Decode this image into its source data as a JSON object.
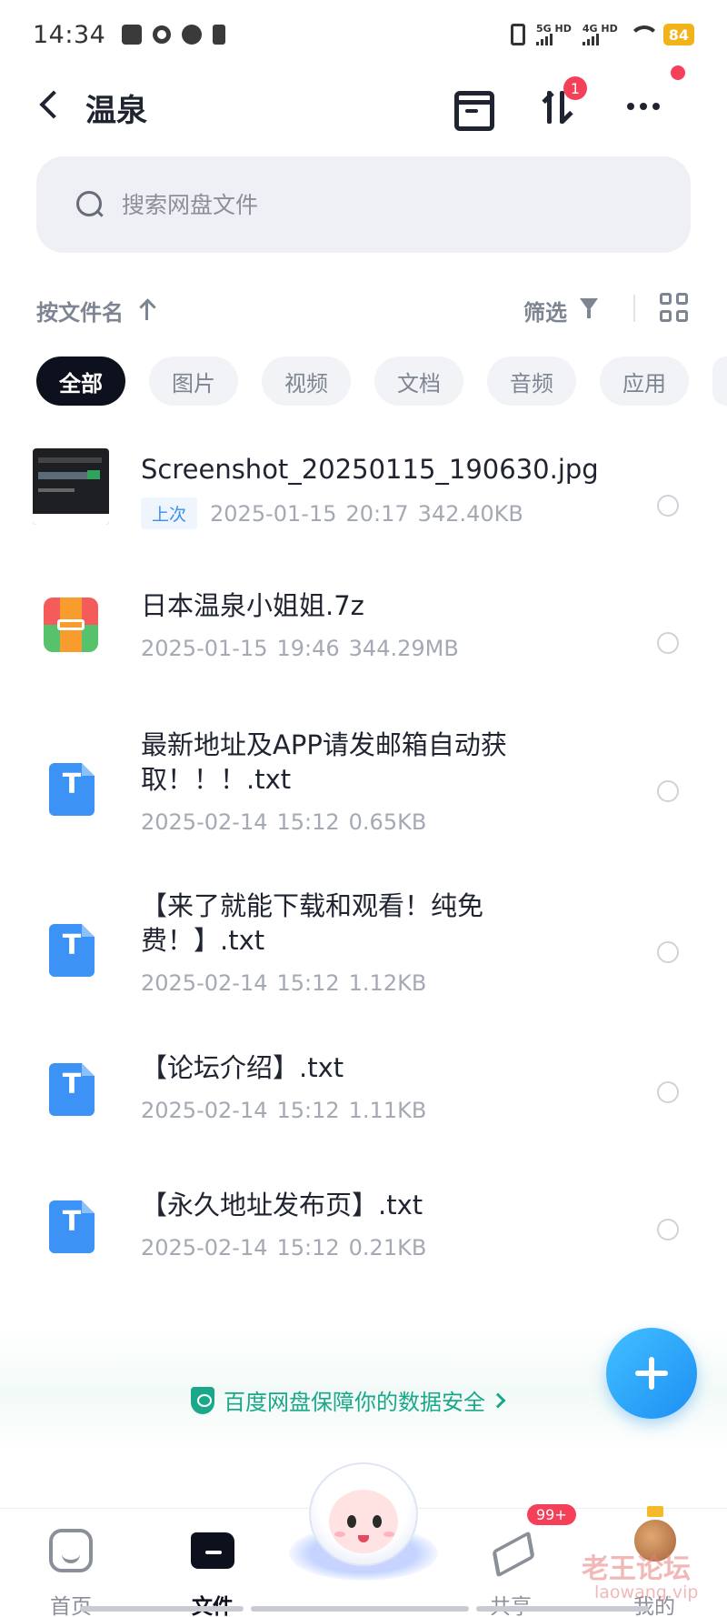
{
  "status_bar": {
    "time": "14:34",
    "network1": "5G HD",
    "network2": "4G HD",
    "battery": "84"
  },
  "header": {
    "title": "温泉",
    "transfer_badge": "1"
  },
  "search": {
    "placeholder": "搜索网盘文件"
  },
  "sort": {
    "label": "按文件名",
    "filter_label": "筛选"
  },
  "tabs": [
    {
      "label": "全部",
      "active": true
    },
    {
      "label": "图片"
    },
    {
      "label": "视频"
    },
    {
      "label": "文档"
    },
    {
      "label": "音频"
    },
    {
      "label": "应用"
    }
  ],
  "files": [
    {
      "name": "Screenshot_20250115_190630.jpg",
      "tag": "上次",
      "date": "2025-01-15",
      "time": "20:17",
      "size": "342.40KB",
      "icon": "image-thumbnail"
    },
    {
      "name": "日本温泉小姐姐.7z",
      "date": "2025-01-15",
      "time": "19:46",
      "size": "344.29MB",
      "icon": "zip-archive-icon"
    },
    {
      "name": "最新地址及APP请发邮箱自动获取！！！.txt",
      "date": "2025-02-14",
      "time": "15:12",
      "size": "0.65KB",
      "icon": "txt-file-icon"
    },
    {
      "name": "【来了就能下载和观看！纯免费！】.txt",
      "date": "2025-02-14",
      "time": "15:12",
      "size": "1.12KB",
      "icon": "txt-file-icon"
    },
    {
      "name": "【论坛介绍】.txt",
      "date": "2025-02-14",
      "time": "15:12",
      "size": "1.11KB",
      "icon": "txt-file-icon"
    },
    {
      "name": "【永久地址发布页】.txt",
      "date": "2025-02-14",
      "time": "15:12",
      "size": "0.21KB",
      "icon": "txt-file-icon"
    }
  ],
  "security_notice": "百度网盘保障你的数据安全",
  "bottom_nav": {
    "home": "首页",
    "files": "文件",
    "share": "共享",
    "mine": "我的",
    "share_badge": "99+"
  },
  "watermark": {
    "main": "老王论坛",
    "sub": "laowang.vip"
  },
  "colors": {
    "accent": "#3d92f5",
    "badge": "#f5405a",
    "security_green": "#1ba88a",
    "active_tab": "#0c111d"
  }
}
